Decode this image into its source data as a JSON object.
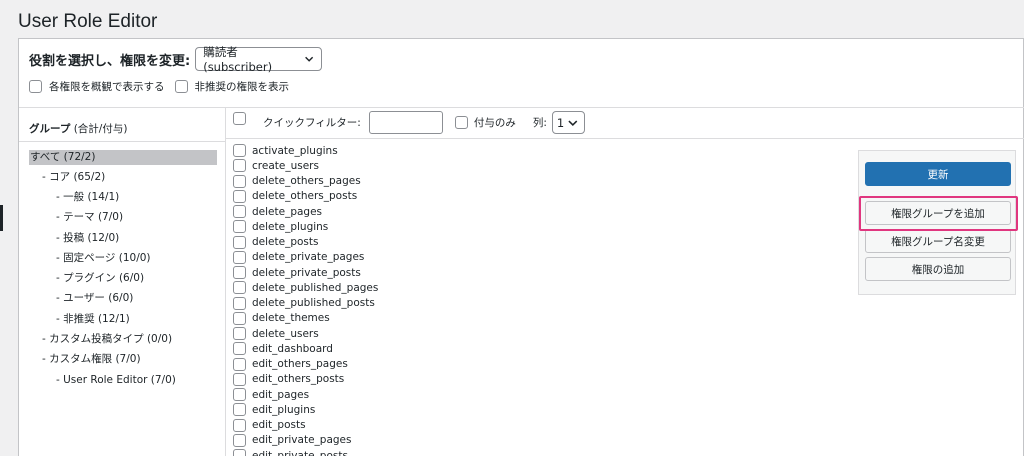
{
  "page_title": "User Role Editor",
  "role": {
    "label": "役割を選択し、権限を変更:",
    "selected": "購読者 (subscriber)"
  },
  "options": {
    "human_readable": "各権限を概観で表示する",
    "deprecated": "非推奨の権限を表示"
  },
  "groups": {
    "header_bold": "グループ",
    "header_rest": " (合計/付与)",
    "items": [
      {
        "label": "すべて (72/2)",
        "selected": true
      },
      {
        "label": "- コア (65/2)"
      },
      {
        "label": "- 一般 (14/1)"
      },
      {
        "label": "- テーマ (7/0)"
      },
      {
        "label": "- 投稿 (12/0)"
      },
      {
        "label": "- 固定ページ (10/0)"
      },
      {
        "label": "- プラグイン (6/0)"
      },
      {
        "label": "- ユーザー (6/0)"
      },
      {
        "label": "- 非推奨 (12/1)"
      },
      {
        "label": "- カスタム投稿タイプ (0/0)"
      },
      {
        "label": "- カスタム権限 (7/0)"
      },
      {
        "label": "- User Role Editor (7/0)"
      }
    ]
  },
  "filter": {
    "label": "クイックフィルター:",
    "value": "",
    "granted_only": "付与のみ",
    "columns_label": "列:",
    "columns_value": "1"
  },
  "capabilities": [
    "activate_plugins",
    "create_users",
    "delete_others_pages",
    "delete_others_posts",
    "delete_pages",
    "delete_plugins",
    "delete_posts",
    "delete_private_pages",
    "delete_private_posts",
    "delete_published_pages",
    "delete_published_posts",
    "delete_themes",
    "delete_users",
    "edit_dashboard",
    "edit_others_pages",
    "edit_others_posts",
    "edit_pages",
    "edit_plugins",
    "edit_posts",
    "edit_private_pages",
    "edit_private_posts"
  ],
  "actions": {
    "update": "更新",
    "add_group": "権限グループを追加",
    "rename_group": "権限グループ名変更",
    "add_capability": "権限の追加"
  },
  "colors": {
    "primary": "#2271b1",
    "highlight": "#e0367f"
  }
}
